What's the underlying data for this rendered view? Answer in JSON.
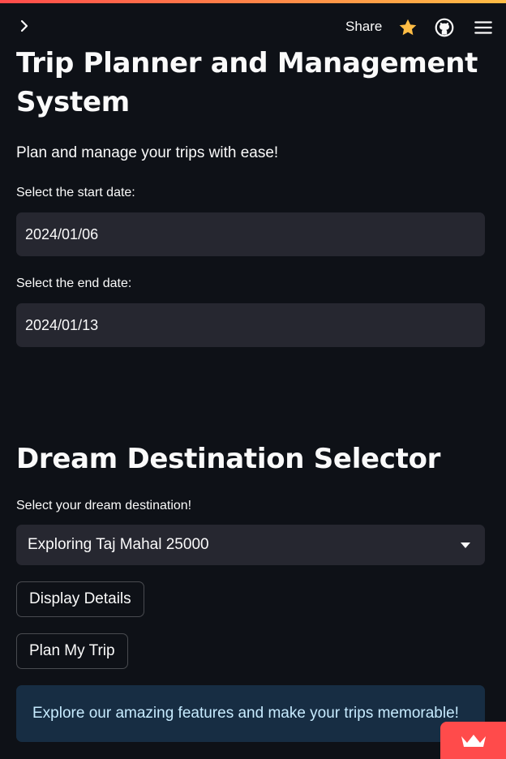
{
  "header": {
    "share_label": "Share",
    "icons": [
      "chevron-right-icon",
      "star-icon",
      "github-icon",
      "hamburger-menu-icon"
    ],
    "accent_gradient": [
      "#ff4b4b",
      "#ffbd45"
    ]
  },
  "main": {
    "title": "Trip Planner and Management System",
    "subtitle": "Plan and manage your trips with ease!",
    "start_date": {
      "label": "Select the start date:",
      "value": "2024/01/06"
    },
    "end_date": {
      "label": "Select the end date:",
      "value": "2024/01/13"
    }
  },
  "destination": {
    "title": "Dream Destination Selector",
    "label": "Select your dream destination!",
    "selected": "Exploring Taj Mahal 25000",
    "display_button": "Display Details",
    "plan_button": "Plan My Trip",
    "info_text": "Explore our amazing features and make your trips memorable!"
  },
  "colors": {
    "background": "#0e1117",
    "input_bg": "#262730",
    "info_bg": "#172d43",
    "star": "#ffbd45",
    "badge": "#ff4b4b"
  }
}
